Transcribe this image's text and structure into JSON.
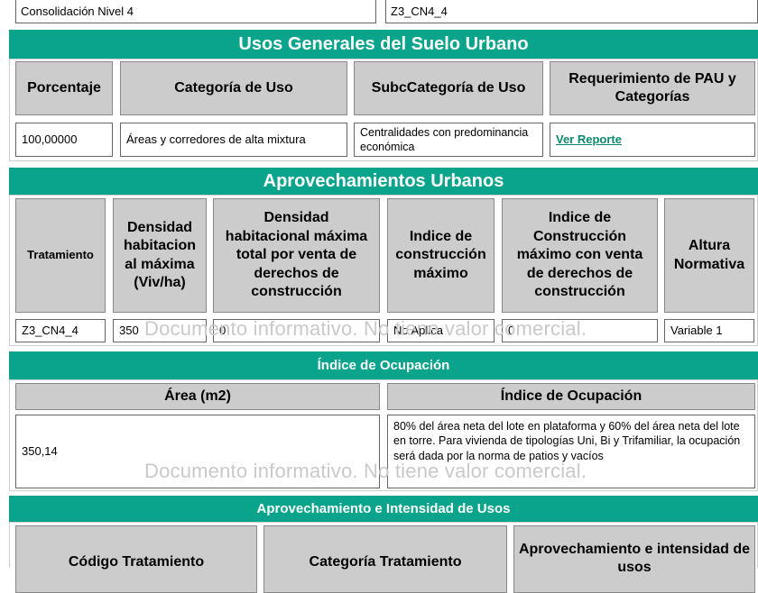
{
  "top_row": {
    "left": "Consolidación Nivel 4",
    "right": "Z3_CN4_4"
  },
  "usos": {
    "title": "Usos Generales del Suelo Urbano",
    "headers": [
      "Porcentaje",
      "Categoría de Uso",
      "SubcCategoría de Uso",
      "Requerimiento de PAU y Categorías"
    ],
    "values": {
      "porcentaje": "100,00000",
      "categoria": "Áreas y corredores de alta mixtura",
      "subcategoria": "Centralidades con predominancia económica",
      "reporte_link": "Ver Reporte"
    }
  },
  "aprovechamientos": {
    "title": "Aprovechamientos Urbanos",
    "headers": [
      "Tratamiento",
      "Densidad habitacion al máxima (Viv/ha)",
      "Densidad habitacional máxima total por venta de derechos de construcción",
      "Indice de construcción máximo",
      "Indice de Construcción máximo con venta de derechos de construcción",
      "Altura Normativa"
    ],
    "values": [
      "Z3_CN4_4",
      "350",
      "0",
      "No Aplica",
      "0",
      "Variable 1"
    ]
  },
  "ocupacion": {
    "title": "Índice de Ocupación",
    "headers": [
      "Área (m2)",
      "Índice de Ocupación"
    ],
    "area": "350,14",
    "indice": "80% del área neta del lote en plataforma y 60% del área neta del lote en torre. Para vivienda de tipologías Uni, Bi y Trifamiliar, la ocupación será dada por la norma de patios y vacíos"
  },
  "intensidad": {
    "title": "Aprovechamiento e Intensidad de Usos",
    "headers": [
      "Código Tratamiento",
      "Categoría Tratamiento",
      "Aprovechamiento e intensidad de usos"
    ]
  },
  "watermark": "Documento informativo. No tiene valor comercial.",
  "colors": {
    "band": "#0aa48c",
    "header_bg": "#cccccc",
    "link": "#0a8a6c",
    "watermark": "#c9c9c9"
  }
}
